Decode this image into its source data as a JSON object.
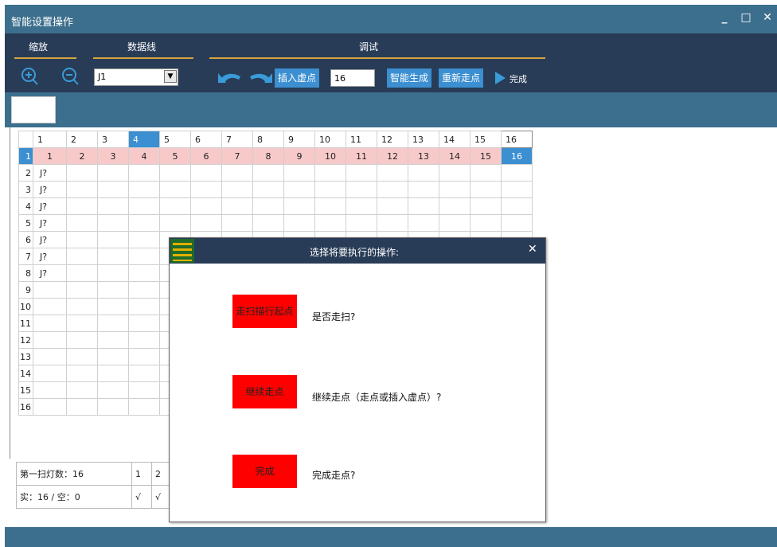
{
  "window": {
    "title": "智能设置操作",
    "minimize": "_",
    "maximize": "□",
    "close": "✕"
  },
  "toolbar": {
    "group_zoom": "缩放",
    "group_dataline": "数据线",
    "group_debug": "调试",
    "dataline_value": "J1",
    "insert_virtual_label": "插入虚点",
    "point_count_value": "16",
    "smart_generate_label": "智能生成",
    "rewalk_label": "重新走点",
    "finish_label": "完成"
  },
  "grid": {
    "columns": [
      "1",
      "2",
      "3",
      "4",
      "5",
      "6",
      "7",
      "8",
      "9",
      "10",
      "11",
      "12",
      "13",
      "14",
      "15",
      "16"
    ],
    "selected_column": "4",
    "rows": [
      "1",
      "2",
      "3",
      "4",
      "5",
      "6",
      "7",
      "8",
      "9",
      "10",
      "11",
      "12",
      "13",
      "14",
      "15",
      "16"
    ],
    "row1_values": [
      "1",
      "2",
      "3",
      "4",
      "5",
      "6",
      "7",
      "8",
      "9",
      "10",
      "11",
      "12",
      "13",
      "14",
      "15",
      "16"
    ],
    "col1_marks": [
      "J?",
      "J?",
      "J?",
      "J?",
      "J?",
      "J?",
      "J?"
    ]
  },
  "summary": {
    "scan_count_label": "第一扫灯数：16",
    "real_empty_label": "实：16 / 空：0",
    "cols": [
      "1",
      "2"
    ],
    "checks": [
      "√",
      "√"
    ]
  },
  "dialog": {
    "title": "选择将要执行的操作:",
    "close": "✕",
    "opt1_button": "走扫描行起点",
    "opt1_question": "是否走扫?",
    "opt2_button": "继续走点",
    "opt2_question": "继续走点（走点或插入虚点）?",
    "opt3_button": "完成",
    "opt3_question": "完成走点?"
  },
  "colors": {
    "title_bar": "#3c6f8d",
    "toolbar": "#283c57",
    "accent_blue": "#3c8fd0",
    "pink_row": "#f7c9c9",
    "red_button": "#ff0000",
    "underline": "#d7a63a"
  }
}
